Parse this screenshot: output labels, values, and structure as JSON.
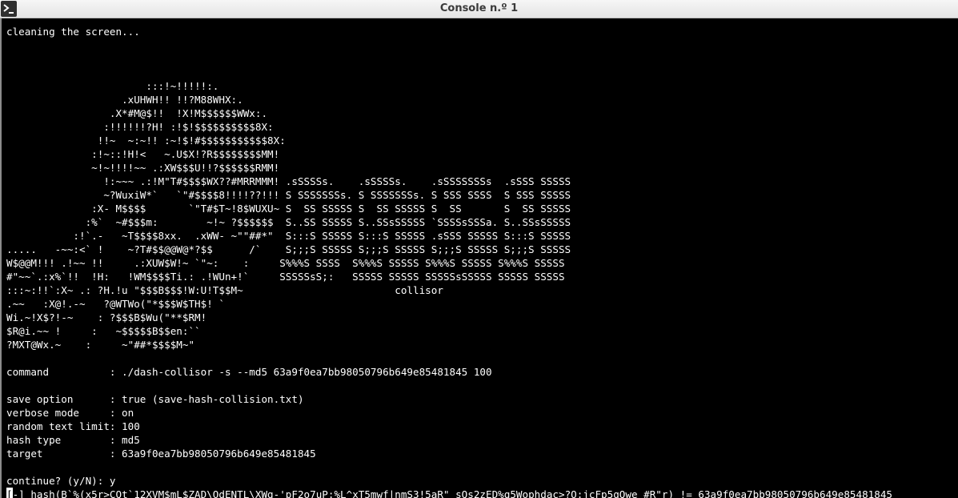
{
  "window": {
    "title": "Console n.º 1"
  },
  "console": {
    "lines": [
      "cleaning the screen...",
      "",
      "",
      "",
      "                       :::!~!!!!!:.",
      "                   .xUHWH!! !!?M88WHX:.",
      "                 .X*#M@$!!  !X!M$$$$$$WWx:.",
      "                :!!!!!!?H! :!$!$$$$$$$$$$8X:",
      "               !!~  ~:~!! :~!$!#$$$$$$$$$$$8X:",
      "              :!~::!H!<   ~.U$X!?R$$$$$$$$MM!",
      "              ~!~!!!!~~ .:XW$$$U!!?$$$$$$RMM!",
      "                !:~~~ .:!M\"T#$$$$WX??#MRRMMM! .sSSSSs.    .sSSSSs.    .sSSSSSSSs  .sSSS SSSSS",
      "                ~?WuxiW*`   `\"#$$$$8!!!!??!!! S SSSSSSSs. S SSSSSSSs. S SSS SSSS  S SSS SSSSS",
      "              :X- M$$$$       `\"T#$T~!8$WUXU~ S  SS SSSSS S  SS SSSSS S  SS       S  SS SSSSS",
      "             :%`  ~#$$$m:        ~!~ ?$$$$$$  S..SS SSSSS S..SSsSSSSS `SSSSsSSSa. S..SSsSSSSS",
      "           :!`.-   ~T$$$$8xx.  .xWW- ~\"\"##*\"  S:::S SSSSS S:::S SSSSS .sSSS SSSSS S:::S SSSSS",
      ".....   -~~:<` !    ~?T#$$@@W@*?$$      /`    S;;;S SSSSS S;;;S SSSSS S;;;S SSSSS S;;;S SSSSS",
      "W$@@M!!! .!~~ !!     .:XUW$W!~ `\"~:    :     S%%%S SSSS  S%%%S SSSSS S%%%S SSSSS S%%%S SSSSS",
      "#\"~~`.:x%`!!  !H:   !WM$$$$Ti.: .!WUn+!`     SSSSSsS;:   SSSSS SSSSS SSSSSsSSSSS SSSSS SSSSS",
      ":::~:!!`:X~ .: ?H.!u \"$$$B$$$!W:U!T$$M~                         collisor",
      ".~~   :X@!.-~   ?@WTWo(\"*$$$W$TH$! `",
      "Wi.~!X$?!-~    : ?$$$B$Wu(\"**$RM!",
      "$R@i.~~ !     :   ~$$$$$B$$en:``",
      "?MXT@Wx.~    :     ~\"##*$$$$M~\"",
      "",
      "command          : ./dash-collisor -s --md5 63a9f0ea7bb98050796b649e85481845 100",
      "",
      "save option      : true (save-hash-collision.txt)",
      "verbose mode     : on",
      "random text limit: 100",
      "hash type        : md5",
      "target           : 63a9f0ea7bb98050796b649e85481845",
      "",
      "continue? (y/N): y"
    ],
    "cursor_char": "[",
    "last_line_rest": "-] hash(B`%(x5r>CQt`12XVM$mL$ZAD\\OdENTL\\XWg-'pF2o7uP:%L^xT5mwf|nmS3!5aR\"_sQs2zED%q5Wophdac>?O:jcFp5gQwe_#R\"r) != 63a9f0ea7bb98050796b649e85481845"
  }
}
